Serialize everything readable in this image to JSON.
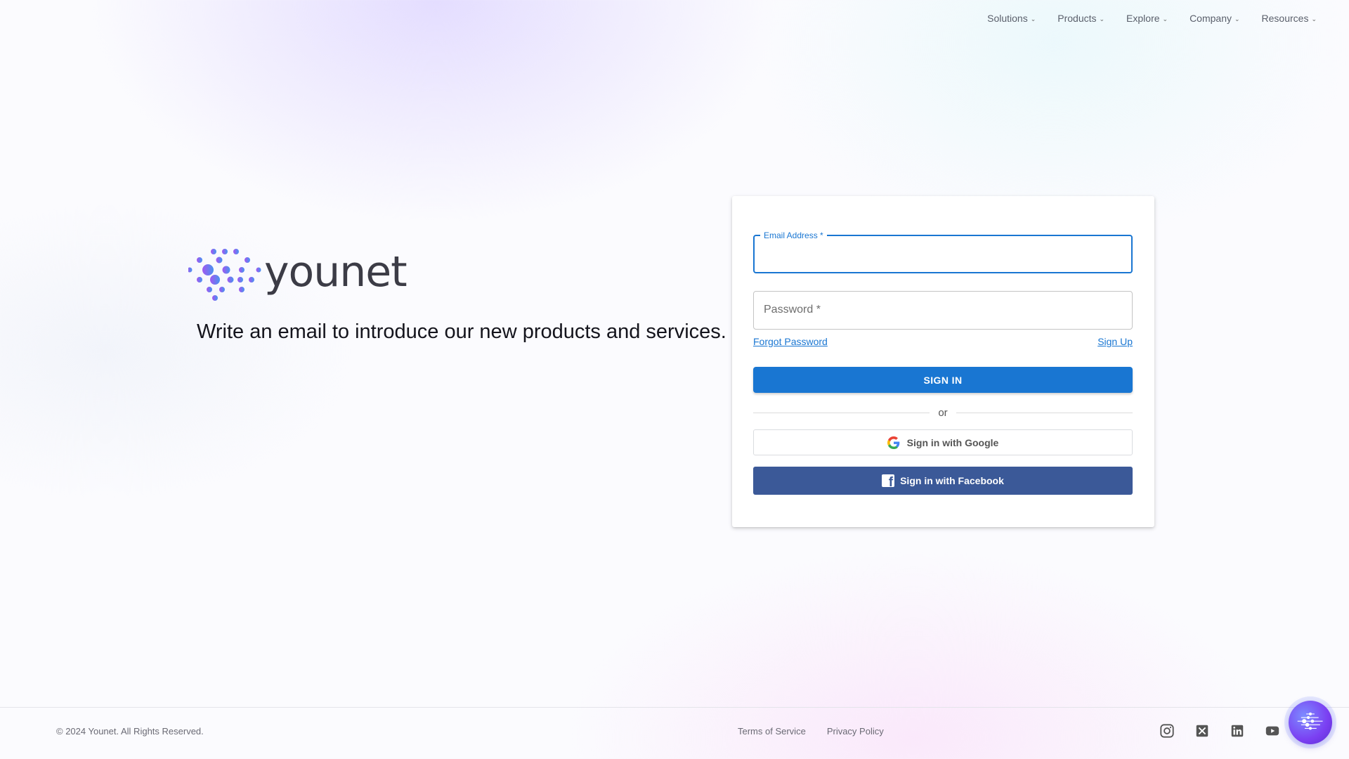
{
  "nav": {
    "items": [
      {
        "label": "Solutions"
      },
      {
        "label": "Products"
      },
      {
        "label": "Explore"
      },
      {
        "label": "Company"
      },
      {
        "label": "Resources"
      }
    ]
  },
  "hero": {
    "brand": "younet",
    "tagline": "Write an email to introduce our new products and services."
  },
  "login": {
    "email_label": "Email Address *",
    "email_value": "",
    "password_label": "Password *",
    "password_value": "",
    "forgot_password": "Forgot Password",
    "sign_up": "Sign Up",
    "sign_in": "SIGN IN",
    "or": "or",
    "google": "Sign in with Google",
    "facebook": "Sign in with Facebook"
  },
  "footer": {
    "copyright": "© 2024 Younet. All Rights Reserved.",
    "terms": "Terms of Service",
    "privacy": "Privacy Policy",
    "socials": [
      "instagram-icon",
      "x-icon",
      "linkedin-icon",
      "youtube-icon"
    ]
  },
  "colors": {
    "primary": "#1976d2",
    "facebook": "#3b5998",
    "fab": "#7b3ff2"
  }
}
